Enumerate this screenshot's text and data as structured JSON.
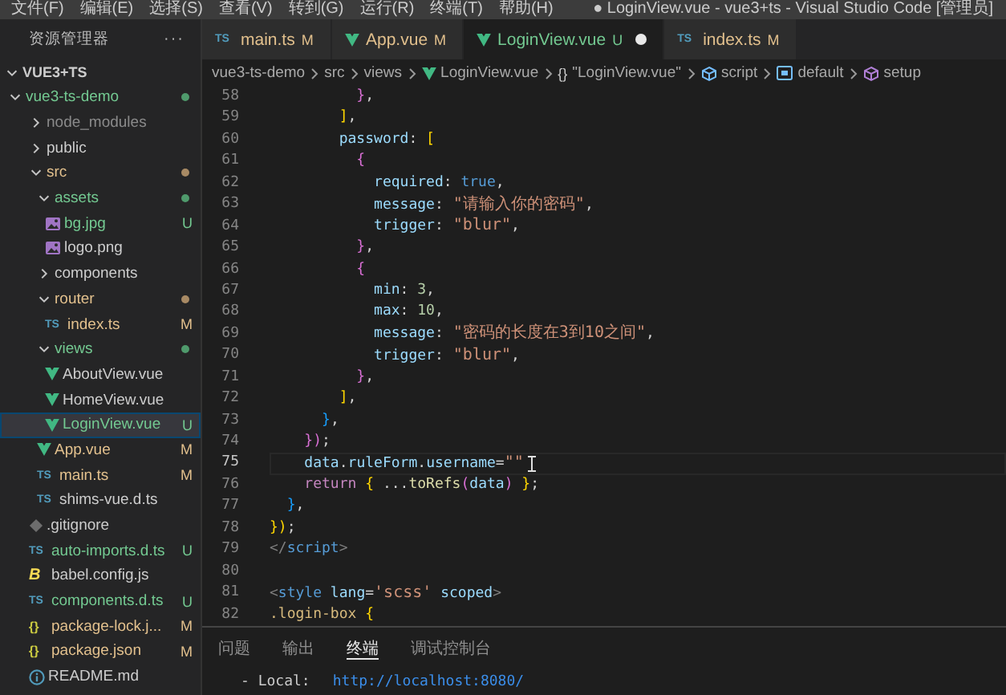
{
  "title_bar": {
    "menu": [
      "文件(F)",
      "编辑(E)",
      "选择(S)",
      "查看(V)",
      "转到(G)",
      "运行(R)",
      "终端(T)",
      "帮助(H)"
    ],
    "title": "● LoginView.vue - vue3+ts - Visual Studio Code [管理员]"
  },
  "sidebar": {
    "title": "资源管理器",
    "more": "···",
    "section": {
      "label": "VUE3+TS",
      "expanded": true
    },
    "tree": [
      {
        "label": "vue3-ts-demo",
        "kind": "folder",
        "expanded": true,
        "modified": false,
        "untracked": true,
        "ignored": false,
        "color": "#4f9a6c",
        "selected": false,
        "children": [
          {
            "label": "node_modules",
            "kind": "folder",
            "expanded": false,
            "modified": false,
            "untracked": false,
            "ignored": true,
            "selected": false
          },
          {
            "label": "public",
            "kind": "folder",
            "expanded": false,
            "modified": false,
            "untracked": false,
            "ignored": false,
            "selected": false
          },
          {
            "label": "src",
            "kind": "folder",
            "expanded": true,
            "modified": true,
            "untracked": false,
            "ignored": false,
            "color": "#a88a64",
            "selected": false,
            "children": [
              {
                "label": "assets",
                "kind": "folder",
                "expanded": true,
                "modified": false,
                "untracked": true,
                "ignored": false,
                "color": "#4f9a6c",
                "selected": false,
                "children": [
                  {
                    "label": "bg.jpg",
                    "kind": "image",
                    "modified": false,
                    "untracked": true,
                    "ignored": false,
                    "badge": "U",
                    "selected": false
                  },
                  {
                    "label": "logo.png",
                    "kind": "image",
                    "modified": false,
                    "untracked": false,
                    "ignored": false,
                    "selected": false
                  }
                ]
              },
              {
                "label": "components",
                "kind": "folder",
                "expanded": false,
                "modified": false,
                "untracked": false,
                "ignored": false,
                "selected": false
              },
              {
                "label": "router",
                "kind": "folder",
                "expanded": true,
                "modified": true,
                "untracked": false,
                "ignored": false,
                "color": "#a88a64",
                "selected": false,
                "children": [
                  {
                    "label": "index.ts",
                    "kind": "ts",
                    "icon_text": "TS",
                    "modified": true,
                    "untracked": false,
                    "ignored": false,
                    "badge": "M",
                    "selected": false
                  }
                ]
              },
              {
                "label": "views",
                "kind": "folder",
                "expanded": true,
                "modified": false,
                "untracked": true,
                "ignored": false,
                "color": "#4f9a6c",
                "selected": false,
                "children": [
                  {
                    "label": "AboutView.vue",
                    "kind": "vue",
                    "modified": false,
                    "untracked": false,
                    "ignored": false,
                    "selected": false
                  },
                  {
                    "label": "HomeView.vue",
                    "kind": "vue",
                    "modified": false,
                    "untracked": false,
                    "ignored": false,
                    "selected": false
                  },
                  {
                    "label": "LoginView.vue",
                    "kind": "vue",
                    "modified": false,
                    "untracked": true,
                    "ignored": false,
                    "badge": "U",
                    "selected": true
                  }
                ]
              },
              {
                "label": "App.vue",
                "kind": "vue",
                "modified": true,
                "untracked": false,
                "ignored": false,
                "badge": "M",
                "selected": false
              },
              {
                "label": "main.ts",
                "kind": "ts",
                "icon_text": "TS",
                "modified": true,
                "untracked": false,
                "ignored": false,
                "badge": "M",
                "selected": false
              },
              {
                "label": "shims-vue.d.ts",
                "kind": "ts",
                "icon_text": "TS",
                "modified": false,
                "untracked": false,
                "ignored": false,
                "selected": false
              }
            ]
          },
          {
            "label": ".gitignore",
            "kind": "git",
            "modified": false,
            "untracked": false,
            "ignored": false,
            "selected": false
          },
          {
            "label": "auto-imports.d.ts",
            "kind": "ts",
            "icon_text": "TS",
            "modified": false,
            "untracked": true,
            "ignored": false,
            "badge": "U",
            "selected": false
          },
          {
            "label": "babel.config.js",
            "kind": "babel",
            "icon_text": "B",
            "modified": false,
            "untracked": false,
            "ignored": false,
            "selected": false
          },
          {
            "label": "components.d.ts",
            "kind": "ts",
            "icon_text": "TS",
            "modified": false,
            "untracked": true,
            "ignored": false,
            "badge": "U",
            "selected": false
          },
          {
            "label": "package-lock.j...",
            "kind": "json",
            "icon_text": "{}",
            "modified": true,
            "untracked": false,
            "ignored": false,
            "badge": "M",
            "selected": false
          },
          {
            "label": "package.json",
            "kind": "json",
            "icon_text": "{}",
            "modified": true,
            "untracked": false,
            "ignored": false,
            "badge": "M",
            "selected": false
          },
          {
            "label": "README.md",
            "kind": "info",
            "modified": false,
            "untracked": false,
            "ignored": false,
            "selected": false
          }
        ]
      }
    ]
  },
  "tabs": [
    {
      "label": "main.ts",
      "kind": "ts",
      "icon_text": "TS",
      "modified": true,
      "untracked": false,
      "badge": "M",
      "selected": false,
      "dirty": false
    },
    {
      "label": "App.vue",
      "kind": "vue",
      "modified": true,
      "untracked": false,
      "badge": "M",
      "selected": false,
      "dirty": false
    },
    {
      "label": "LoginView.vue",
      "kind": "vue",
      "modified": false,
      "untracked": true,
      "badge": "U",
      "selected": true,
      "dirty": true
    },
    {
      "label": "index.ts",
      "kind": "ts",
      "icon_text": "TS",
      "modified": true,
      "untracked": false,
      "badge": "M",
      "selected": false,
      "dirty": false
    }
  ],
  "breadcrumbs": [
    {
      "label": "vue3-ts-demo",
      "kind": "folder"
    },
    {
      "label": "src",
      "kind": "folder"
    },
    {
      "label": "views",
      "kind": "folder"
    },
    {
      "label": "LoginView.vue",
      "kind": "vue"
    },
    {
      "label": "\"LoginView.vue\"",
      "kind": "module",
      "icon_text": "{}"
    },
    {
      "label": "script",
      "kind": "element"
    },
    {
      "label": "default",
      "kind": "variable"
    },
    {
      "label": "setup",
      "kind": "method"
    }
  ],
  "editor": {
    "lines": [
      {
        "number": "58",
        "active": false,
        "pointer": false,
        "tokens": [
          {
            "kind": "b2",
            "text": "          }"
          },
          {
            "kind": "p",
            "text": ","
          }
        ]
      },
      {
        "number": "59",
        "active": false,
        "pointer": false,
        "tokens": [
          {
            "kind": "b1",
            "text": "        ]"
          },
          {
            "kind": "p",
            "text": ","
          }
        ]
      },
      {
        "number": "60",
        "active": false,
        "pointer": false,
        "tokens": [
          {
            "kind": "prop",
            "text": "        password"
          },
          {
            "kind": "p",
            "text": ":"
          },
          {
            "kind": "b1",
            "text": " ["
          }
        ]
      },
      {
        "number": "61",
        "active": false,
        "pointer": false,
        "tokens": [
          {
            "kind": "b2",
            "text": "          {"
          }
        ]
      },
      {
        "number": "62",
        "active": false,
        "pointer": false,
        "tokens": [
          {
            "kind": "prop",
            "text": "            required"
          },
          {
            "kind": "p",
            "text": ":"
          },
          {
            "kind": "kw",
            "text": " true"
          },
          {
            "kind": "p",
            "text": ","
          }
        ]
      },
      {
        "number": "63",
        "active": false,
        "pointer": false,
        "tokens": [
          {
            "kind": "prop",
            "text": "            message"
          },
          {
            "kind": "p",
            "text": ":"
          },
          {
            "kind": "str",
            "text": " \"请输入你的密码\""
          },
          {
            "kind": "p",
            "text": ","
          }
        ]
      },
      {
        "number": "64",
        "active": false,
        "pointer": false,
        "tokens": [
          {
            "kind": "prop",
            "text": "            trigger"
          },
          {
            "kind": "p",
            "text": ":"
          },
          {
            "kind": "str",
            "text": " \"blur\""
          },
          {
            "kind": "p",
            "text": ","
          }
        ]
      },
      {
        "number": "65",
        "active": false,
        "pointer": false,
        "tokens": [
          {
            "kind": "b2",
            "text": "          }"
          },
          {
            "kind": "p",
            "text": ","
          }
        ]
      },
      {
        "number": "66",
        "active": false,
        "pointer": false,
        "tokens": [
          {
            "kind": "b2",
            "text": "          {"
          }
        ]
      },
      {
        "number": "67",
        "active": false,
        "pointer": false,
        "tokens": [
          {
            "kind": "prop",
            "text": "            min"
          },
          {
            "kind": "p",
            "text": ":"
          },
          {
            "kind": "num",
            "text": " 3"
          },
          {
            "kind": "p",
            "text": ","
          }
        ]
      },
      {
        "number": "68",
        "active": false,
        "pointer": false,
        "tokens": [
          {
            "kind": "prop",
            "text": "            max"
          },
          {
            "kind": "p",
            "text": ":"
          },
          {
            "kind": "num",
            "text": " 10"
          },
          {
            "kind": "p",
            "text": ","
          }
        ]
      },
      {
        "number": "69",
        "active": false,
        "pointer": false,
        "tokens": [
          {
            "kind": "prop",
            "text": "            message"
          },
          {
            "kind": "p",
            "text": ":"
          },
          {
            "kind": "str",
            "text": " \"密码的长度在3到10之间\""
          },
          {
            "kind": "p",
            "text": ","
          }
        ]
      },
      {
        "number": "70",
        "active": false,
        "pointer": false,
        "tokens": [
          {
            "kind": "prop",
            "text": "            trigger"
          },
          {
            "kind": "p",
            "text": ":"
          },
          {
            "kind": "str",
            "text": " \"blur\""
          },
          {
            "kind": "p",
            "text": ","
          }
        ]
      },
      {
        "number": "71",
        "active": false,
        "pointer": false,
        "tokens": [
          {
            "kind": "b2",
            "text": "          }"
          },
          {
            "kind": "p",
            "text": ","
          }
        ]
      },
      {
        "number": "72",
        "active": false,
        "pointer": false,
        "tokens": [
          {
            "kind": "b1",
            "text": "        ]"
          },
          {
            "kind": "p",
            "text": ","
          }
        ]
      },
      {
        "number": "73",
        "active": false,
        "pointer": false,
        "tokens": [
          {
            "kind": "b3",
            "text": "      }"
          },
          {
            "kind": "p",
            "text": ","
          }
        ]
      },
      {
        "number": "74",
        "active": false,
        "pointer": false,
        "tokens": [
          {
            "kind": "b2",
            "text": "    })"
          },
          {
            "kind": "p",
            "text": ";"
          }
        ]
      },
      {
        "number": "75",
        "active": true,
        "pointer": true,
        "tokens": [
          {
            "kind": "var",
            "text": "    data"
          },
          {
            "kind": "p",
            "text": "."
          },
          {
            "kind": "prop",
            "text": "ruleForm"
          },
          {
            "kind": "p",
            "text": "."
          },
          {
            "kind": "prop",
            "text": "username"
          },
          {
            "kind": "p",
            "text": "="
          },
          {
            "kind": "str",
            "text": "\"\""
          }
        ]
      },
      {
        "number": "76",
        "active": false,
        "pointer": false,
        "tokens": [
          {
            "kind": "ctrl",
            "text": "    return"
          },
          {
            "kind": "b1",
            "text": " {"
          },
          {
            "kind": "p",
            "text": " ..."
          },
          {
            "kind": "fn",
            "text": "toRefs"
          },
          {
            "kind": "b2",
            "text": "("
          },
          {
            "kind": "var",
            "text": "data"
          },
          {
            "kind": "b2",
            "text": ")"
          },
          {
            "kind": "b1",
            "text": " }"
          },
          {
            "kind": "p",
            "text": ";"
          }
        ]
      },
      {
        "number": "77",
        "active": false,
        "pointer": false,
        "tokens": [
          {
            "kind": "b3",
            "text": "  }"
          },
          {
            "kind": "p",
            "text": ","
          }
        ]
      },
      {
        "number": "78",
        "active": false,
        "pointer": false,
        "tokens": [
          {
            "kind": "b1",
            "text": "})"
          },
          {
            "kind": "p",
            "text": ";"
          }
        ]
      },
      {
        "number": "79",
        "active": false,
        "pointer": false,
        "tokens": [
          {
            "kind": "tag",
            "text": "</"
          },
          {
            "kind": "tagname",
            "text": "script"
          },
          {
            "kind": "tag",
            "text": ">"
          }
        ]
      },
      {
        "number": "80",
        "active": false,
        "pointer": false
      },
      {
        "number": "81",
        "active": false,
        "pointer": false,
        "tokens": [
          {
            "kind": "tag",
            "text": "<"
          },
          {
            "kind": "tagname",
            "text": "style"
          },
          {
            "kind": "attr",
            "text": " lang"
          },
          {
            "kind": "p",
            "text": "="
          },
          {
            "kind": "str",
            "text": "'scss'"
          },
          {
            "kind": "attr",
            "text": " scoped"
          },
          {
            "kind": "tag",
            "text": ">"
          }
        ]
      },
      {
        "number": "82",
        "active": false,
        "pointer": false,
        "tokens": [
          {
            "kind": "sel",
            "text": ".login-box"
          },
          {
            "kind": "b1",
            "text": " {"
          }
        ]
      }
    ]
  },
  "panel": {
    "tabs": [
      {
        "label": "问题",
        "selected": false
      },
      {
        "label": "输出",
        "selected": false
      },
      {
        "label": "终端",
        "selected": true
      },
      {
        "label": "调试控制台",
        "selected": false
      }
    ],
    "terminal": [
      {
        "kind": "label",
        "text": "- Local:"
      },
      {
        "kind": "link",
        "text": "http://localhost:8080/"
      }
    ]
  }
}
